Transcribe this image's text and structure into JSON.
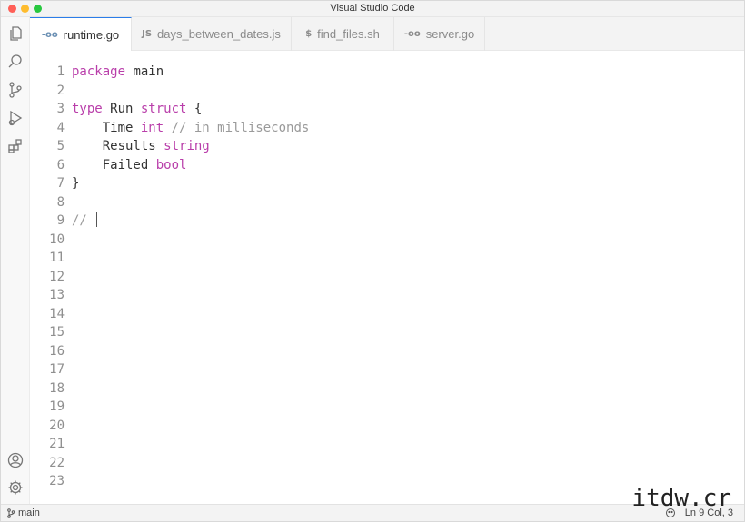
{
  "window": {
    "title": "Visual Studio Code"
  },
  "activity_bar": {
    "top_icons": [
      "files-icon",
      "search-icon",
      "source-control-icon",
      "run-debug-icon",
      "extensions-icon"
    ],
    "bottom_icons": [
      "account-icon",
      "settings-gear-icon"
    ]
  },
  "tabs": [
    {
      "label": "runtime.go",
      "icon_text": "-oo",
      "active": true
    },
    {
      "label": "days_between_dates.js",
      "icon_text": "JS",
      "active": false
    },
    {
      "label": "find_files.sh",
      "icon_text": "$",
      "active": false
    },
    {
      "label": "server.go",
      "icon_text": "-oo",
      "active": false
    }
  ],
  "editor": {
    "lines": [
      {
        "n": "1",
        "segments": [
          {
            "t": "package",
            "c": "kw"
          },
          {
            "t": " main",
            "c": ""
          }
        ]
      },
      {
        "n": "2",
        "segments": []
      },
      {
        "n": "3",
        "segments": [
          {
            "t": "type",
            "c": "kw"
          },
          {
            "t": " Run ",
            "c": ""
          },
          {
            "t": "struct",
            "c": "kw"
          },
          {
            "t": " {",
            "c": ""
          }
        ]
      },
      {
        "n": "4",
        "segments": [
          {
            "t": "    Time ",
            "c": ""
          },
          {
            "t": "int",
            "c": "kw"
          },
          {
            "t": " // in milliseconds",
            "c": "cm"
          }
        ]
      },
      {
        "n": "5",
        "segments": [
          {
            "t": "    Results ",
            "c": ""
          },
          {
            "t": "string",
            "c": "kw"
          }
        ]
      },
      {
        "n": "6",
        "segments": [
          {
            "t": "    Failed ",
            "c": ""
          },
          {
            "t": "bool",
            "c": "kw"
          }
        ]
      },
      {
        "n": "7",
        "segments": [
          {
            "t": "}",
            "c": ""
          }
        ]
      },
      {
        "n": "8",
        "segments": []
      },
      {
        "n": "9",
        "segments": [
          {
            "t": "// ",
            "c": "cm"
          }
        ],
        "caret": true
      },
      {
        "n": "10",
        "segments": []
      },
      {
        "n": "11",
        "segments": []
      },
      {
        "n": "12",
        "segments": []
      },
      {
        "n": "13",
        "segments": []
      },
      {
        "n": "14",
        "segments": []
      },
      {
        "n": "15",
        "segments": []
      },
      {
        "n": "16",
        "segments": []
      },
      {
        "n": "17",
        "segments": []
      },
      {
        "n": "18",
        "segments": []
      },
      {
        "n": "19",
        "segments": []
      },
      {
        "n": "20",
        "segments": []
      },
      {
        "n": "21",
        "segments": []
      },
      {
        "n": "22",
        "segments": []
      },
      {
        "n": "23",
        "segments": []
      }
    ]
  },
  "status_bar": {
    "branch": "main",
    "cursor_position": "Ln 9 Col, 3"
  },
  "watermark": "itdw.cr",
  "colors": {
    "keyword": "#b93eaa",
    "comment": "#9a9a9a",
    "active_tab_accent": "#2b7de9"
  }
}
